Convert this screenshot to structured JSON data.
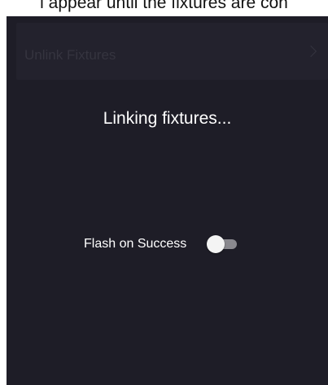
{
  "cut_text": "l appear until the fixtures are con",
  "unlink_row": {
    "label": "Unlink Fixtures"
  },
  "status": {
    "text": "Linking fixtures..."
  },
  "flash_on_success": {
    "label": "Flash on Success",
    "enabled": false
  },
  "colors": {
    "panel_background": "#1e1d27",
    "text": "#ffffff",
    "disabled_text": "#35343f"
  }
}
